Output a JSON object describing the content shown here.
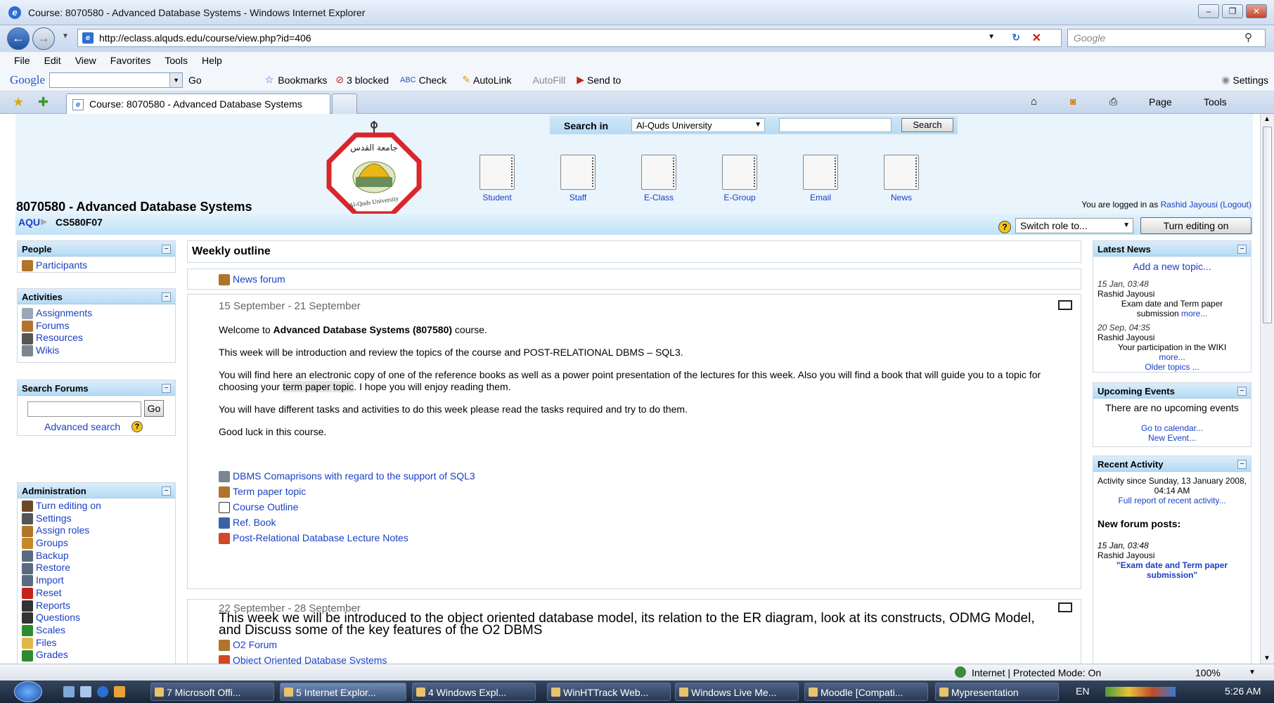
{
  "window": {
    "title": "Course: 8070580 - Advanced Database Systems - Windows Internet Explorer"
  },
  "address": {
    "url": "http://eclass.alquds.edu/course/view.php?id=406",
    "search_placeholder": "Google"
  },
  "menu": [
    "File",
    "Edit",
    "View",
    "Favorites",
    "Tools",
    "Help"
  ],
  "toolbar": {
    "google": "Google",
    "go": "Go",
    "bookmarks": "Bookmarks",
    "blocked": "3 blocked",
    "check": "Check",
    "autolink": "AutoLink",
    "autofill": "AutoFill",
    "sendto": "Send to",
    "settings": "Settings"
  },
  "tab": {
    "label": "Course: 8070580 - Advanced Database Systems",
    "page": "Page",
    "tools": "Tools"
  },
  "header": {
    "search_label": "Search in",
    "search_scope": "Al-Quds University",
    "search_button": "Search",
    "nav": [
      "Student",
      "Staff",
      "E-Class",
      "E-Group",
      "Email",
      "News"
    ]
  },
  "course": {
    "title": "8070580 - Advanced Database Systems",
    "login_prefix": "You are logged in as",
    "login_user": "Rashid Jayousi",
    "logout": "(Logout)",
    "breadcrumb_root": "AQU",
    "breadcrumb_current": "CS580F07",
    "switch_role": "Switch role to...",
    "turn_editing": "Turn editing on"
  },
  "people": {
    "title": "People",
    "items": [
      "Participants"
    ]
  },
  "activities": {
    "title": "Activities",
    "items": [
      "Assignments",
      "Forums",
      "Resources",
      "Wikis"
    ]
  },
  "search_forums": {
    "title": "Search Forums",
    "go": "Go",
    "advanced": "Advanced search"
  },
  "administration": {
    "title": "Administration",
    "items": [
      "Turn editing on",
      "Settings",
      "Assign roles",
      "Groups",
      "Backup",
      "Restore",
      "Import",
      "Reset",
      "Reports",
      "Questions",
      "Scales",
      "Files",
      "Grades"
    ]
  },
  "main": {
    "heading": "Weekly outline",
    "news_forum": "News forum",
    "week1": {
      "dates": "15 September - 21 September",
      "welcome_pre": "Welcome to ",
      "welcome_bold": "Advanced Database Systems (807580)",
      "welcome_post": " course.",
      "p1": "This week will be introduction and review the topics of the course and POST-RELATIONAL DBMS – SQL3.",
      "p2_pre": "You will find here an electronic copy of one of the reference books as well as a power point presentation of the lectures for this week. Also you will find a book that will guide you to a topic for choosing your ",
      "p2_hl": "term paper topic",
      "p2_post": ". I hope you will enjoy reading them.",
      "p3": "You will have different tasks and activities to do this week please read the tasks required and try to do them.",
      "p4": "Good luck in this course.",
      "links": [
        "DBMS Comaprisons with regard to the support of SQL3",
        "Term paper topic",
        "Course Outline",
        "Ref. Book",
        "Post-Relational Database Lecture Notes"
      ]
    },
    "week2": {
      "dates": "22 September - 28 September",
      "intro": "This week we will be introduced to the object oriented database model, its relation to the ER diagram, look at its constructs, ODMG Model, and Discuss some of the key features of the O2 DBMS",
      "links": [
        "O2 Forum",
        "Object Oriented Database Systems"
      ]
    }
  },
  "latest_news": {
    "title": "Latest News",
    "add": "Add a new topic...",
    "posts": [
      {
        "date": "15 Jan, 03:48",
        "author": "Rashid Jayousi",
        "text": "Exam date and Term paper submission",
        "more": "more..."
      },
      {
        "date": "20 Sep, 04:35",
        "author": "Rashid Jayousi",
        "text": "Your participation in the WIKI",
        "more": "more..."
      }
    ],
    "older": "Older topics ..."
  },
  "upcoming": {
    "title": "Upcoming Events",
    "none": "There are no upcoming events",
    "calendar": "Go to calendar...",
    "new_event": "New Event..."
  },
  "recent": {
    "title": "Recent Activity",
    "since": "Activity since Sunday, 13 January 2008, 04:14 AM",
    "full": "Full report of recent activity...",
    "new_posts": "New forum posts:",
    "post_date": "15 Jan, 03:48",
    "post_author": "Rashid Jayousi",
    "post_title": "\"Exam date and Term paper submission\""
  },
  "status": {
    "zone": "Internet | Protected Mode: On",
    "zoom": "100%"
  },
  "taskbar": {
    "items": [
      "7 Microsoft Offi...",
      "5 Internet Explor...",
      "4 Windows Expl...",
      "WinHTTrack Web...",
      "Windows Live Me...",
      "Moodle [Compati...",
      "Mypresentation"
    ],
    "lang": "EN",
    "time": "5:26 AM"
  }
}
